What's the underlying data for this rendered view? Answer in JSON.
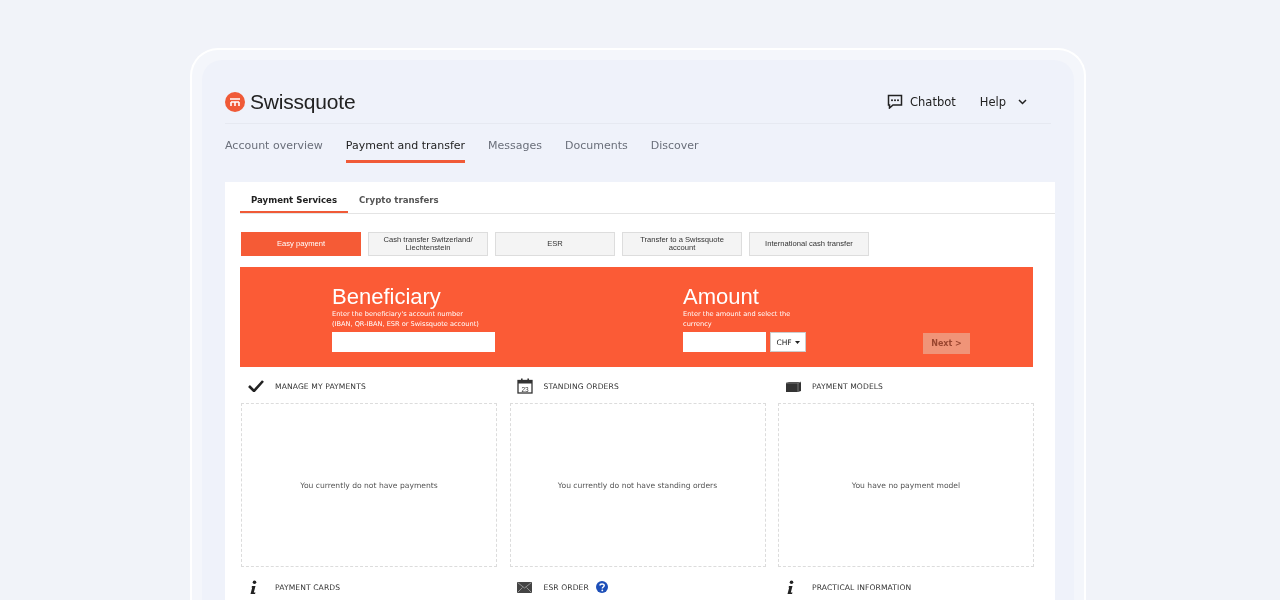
{
  "header": {
    "logo": "Swissquote",
    "chatbot": "Chatbot",
    "help": "Help"
  },
  "nav": [
    {
      "label": "Account overview",
      "selected": false
    },
    {
      "label": "Payment and transfer",
      "selected": true
    },
    {
      "label": "Messages",
      "selected": false
    },
    {
      "label": "Documents",
      "selected": false
    },
    {
      "label": "Discover",
      "selected": false
    }
  ],
  "tabs": [
    {
      "label": "Payment Services",
      "selected": true
    },
    {
      "label": "Crypto transfers",
      "selected": false
    }
  ],
  "services": [
    {
      "label": "Easy payment",
      "selected": true
    },
    {
      "label": "Cash transfer Switzerland/ Liechtenstein",
      "selected": false
    },
    {
      "label": "ESR",
      "selected": false
    },
    {
      "label": "Transfer to a Swissquote account",
      "selected": false
    },
    {
      "label": "International cash transfer",
      "selected": false
    }
  ],
  "beneficiary": {
    "title": "Beneficiary",
    "hint": "Enter the beneficiary's account number\n(IBAN, QR-IBAN, ESR or Swissquote account)"
  },
  "amount": {
    "title": "Amount",
    "hint": "Enter the amount and select the currency",
    "currency": "CHF"
  },
  "next": {
    "label": "Next >",
    "disabled": true
  },
  "sections": [
    {
      "kind": "check",
      "title": "MANAGE MY PAYMENTS",
      "empty": "You currently do not have payments"
    },
    {
      "kind": "calendar",
      "title": "STANDING ORDERS",
      "calendar_day": "23",
      "empty": "You currently do not have standing orders"
    },
    {
      "kind": "stack",
      "title": "PAYMENT MODELS",
      "empty": "You have no payment model"
    },
    {
      "kind": "info",
      "title": "PAYMENT CARDS",
      "help": false
    },
    {
      "kind": "envelope",
      "title": "ESR ORDER",
      "help": true
    },
    {
      "kind": "info",
      "title": "PRACTICAL INFORMATION",
      "help": false
    }
  ]
}
